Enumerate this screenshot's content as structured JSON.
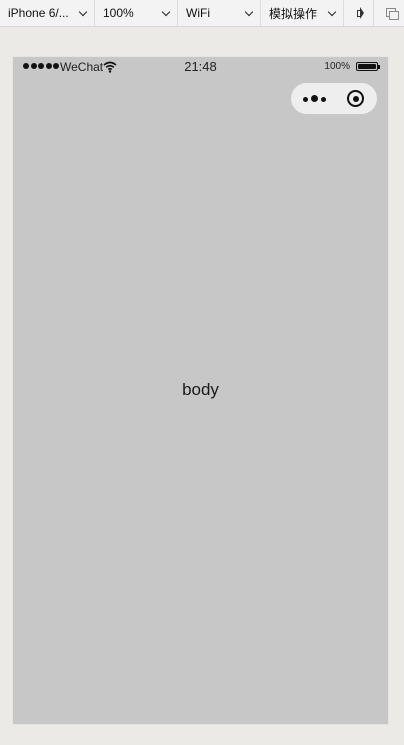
{
  "toolbar": {
    "device": "iPhone 6/...",
    "zoom": "100%",
    "network": "WiFi",
    "simulate": "模拟操作"
  },
  "statusbar": {
    "carrier": "WeChat",
    "time": "21:48",
    "battery": "100%"
  },
  "capsule": {
    "more_icon": "more-dots-icon",
    "close_icon": "target-close-icon"
  },
  "page": {
    "body_text": "body",
    "background": "#c7c7c7"
  }
}
